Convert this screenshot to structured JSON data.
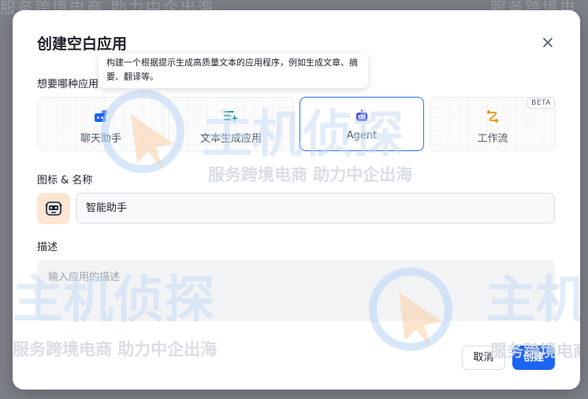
{
  "modal": {
    "title": "创建空白应用",
    "close_icon": "close-icon"
  },
  "tooltip": {
    "text": "构建一个根据提示生成高质量文本的应用程序，例如生成文章、摘要、翻译等。"
  },
  "type_section": {
    "label": "想要哪种应用",
    "cards": [
      {
        "label": "聊天助手",
        "icon": "chat-bot-icon",
        "color": "#1c64f2",
        "selected": false
      },
      {
        "label": "文本生成应用",
        "icon": "text-sparkle-icon",
        "color": "#0e9384",
        "selected": false
      },
      {
        "label": "Agent",
        "icon": "robot-icon",
        "color": "#444ce7",
        "selected": true
      },
      {
        "label": "工作流",
        "icon": "workflow-icon",
        "color": "#f79009",
        "selected": false,
        "badge": "BETA"
      }
    ]
  },
  "name_section": {
    "label": "图标 & 名称",
    "avatar_icon": "robot-emoji-icon",
    "value": "智能助手"
  },
  "desc_section": {
    "label": "描述",
    "placeholder": "输入应用的描述"
  },
  "footer": {
    "cancel_label": "取消",
    "create_label": "创建"
  },
  "watermark": {
    "brand": "主机侦探",
    "slogan": "服务跨境电商 助力中企出海"
  },
  "colors": {
    "accent": "#1c64f2",
    "selected_border": "#2b6ff4"
  }
}
